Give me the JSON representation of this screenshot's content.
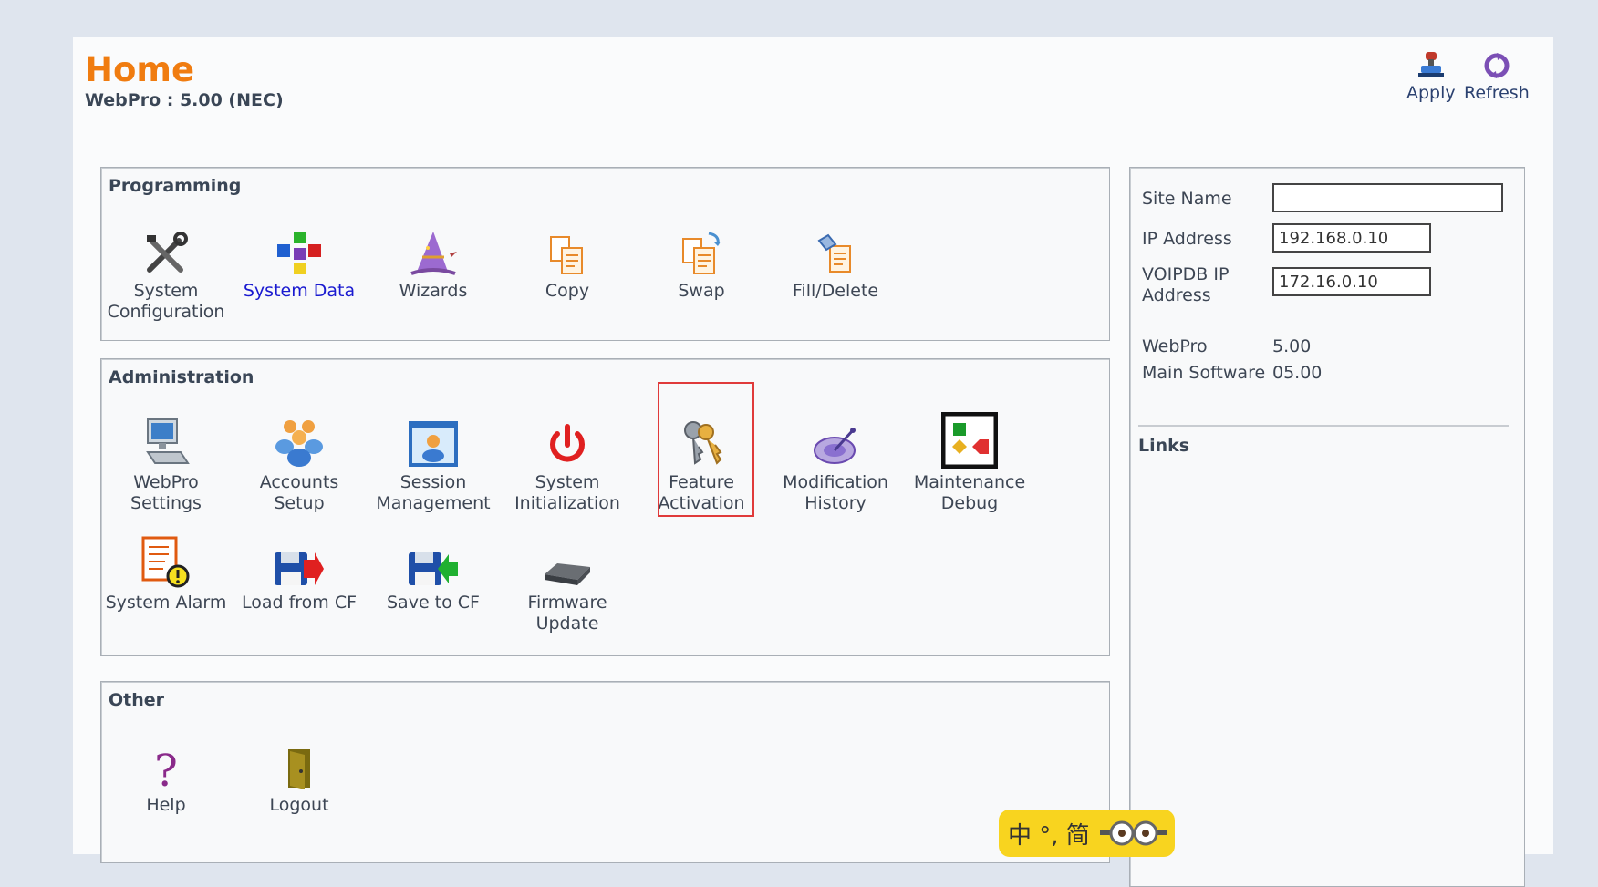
{
  "header": {
    "title": "Home",
    "subtitle": "WebPro : 5.00 (NEC)",
    "apply_label": "Apply",
    "refresh_label": "Refresh"
  },
  "programming": {
    "title": "Programming",
    "items": [
      {
        "label": "System Configuration",
        "icon": "tools-icon"
      },
      {
        "label": "System Data",
        "icon": "cubes-icon"
      },
      {
        "label": "Wizards",
        "icon": "wizard-hat-icon"
      },
      {
        "label": "Copy",
        "icon": "copy-icon"
      },
      {
        "label": "Swap",
        "icon": "swap-icon"
      },
      {
        "label": "Fill/Delete",
        "icon": "fill-delete-icon"
      }
    ]
  },
  "administration": {
    "title": "Administration",
    "items": [
      {
        "label": "WebPro Settings",
        "icon": "computer-icon"
      },
      {
        "label": "Accounts Setup",
        "icon": "users-icon"
      },
      {
        "label": "Session Management",
        "icon": "session-icon"
      },
      {
        "label": "System Initialization",
        "icon": "power-icon"
      },
      {
        "label": "Feature Activation",
        "icon": "keys-icon"
      },
      {
        "label": "Modification History",
        "icon": "history-icon"
      },
      {
        "label": "Maintenance Debug",
        "icon": "debug-icon"
      },
      {
        "label": "System Alarm",
        "icon": "alarm-icon"
      },
      {
        "label": "Load from CF",
        "icon": "load-cf-icon"
      },
      {
        "label": "Save to CF",
        "icon": "save-cf-icon"
      },
      {
        "label": "Firmware Update",
        "icon": "firmware-icon"
      }
    ]
  },
  "other": {
    "title": "Other",
    "items": [
      {
        "label": "Help",
        "icon": "help-icon"
      },
      {
        "label": "Logout",
        "icon": "logout-icon"
      }
    ]
  },
  "side": {
    "site_name_label": "Site Name",
    "site_name_value": "",
    "ip_label": "IP Address",
    "ip_value": "192.168.0.10",
    "voipdb_label": "VOIPDB IP Address",
    "voipdb_value": "172.16.0.10",
    "webpro_label": "WebPro",
    "webpro_value": "5.00",
    "main_sw_label": "Main Software",
    "main_sw_value": "05.00",
    "links_title": "Links"
  },
  "ime": {
    "text": "中 °, 简"
  }
}
